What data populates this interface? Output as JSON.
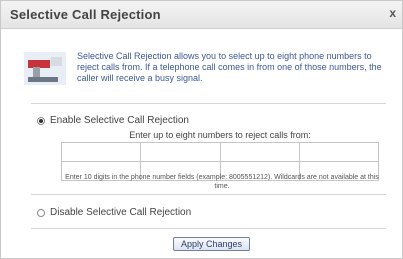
{
  "dialog": {
    "title": "Selective Call Rejection",
    "close_glyph": "x"
  },
  "intro": {
    "icon": "phone-block-icon",
    "text": "Selective Call Rejection allows you to select up to eight phone numbers to reject calls from. If a telephone call comes in from one of those numbers, the caller will receive a busy signal."
  },
  "enable": {
    "label": "Enable Selective Call Rejection",
    "checked": true,
    "instructions": "Enter up to eight numbers to reject calls from:",
    "numbers": [
      "",
      "",
      "",
      "",
      "",
      "",
      "",
      ""
    ],
    "note": "Enter 10 digits in the phone number fields (example: 8005551212). Wildcards are not available at this time."
  },
  "disable": {
    "label": "Disable Selective Call Rejection",
    "checked": false
  },
  "apply_button": "Apply Changes",
  "colors": {
    "accent": "#3b5a95",
    "icon_red": "#c8323a"
  }
}
